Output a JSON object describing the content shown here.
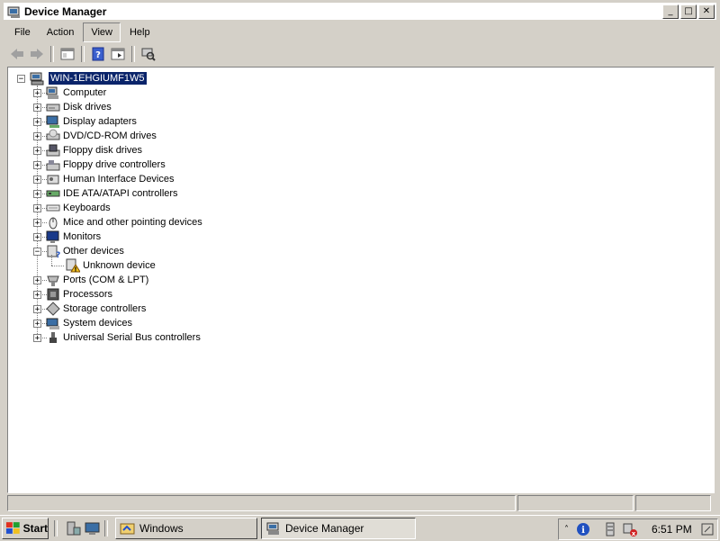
{
  "window": {
    "title": "Device Manager",
    "minimize": "_",
    "maximize": "□",
    "close": "✕"
  },
  "menu": [
    "File",
    "Action",
    "View",
    "Help"
  ],
  "toolbar": {
    "icons": [
      "back-icon",
      "forward-icon",
      "properties-pane-icon",
      "help-icon",
      "show-hide-tree-icon",
      "scan-hardware-icon"
    ]
  },
  "tree": {
    "root": "WIN-1EHGIUMF1W5",
    "categories": [
      {
        "label": "Computer",
        "icon": "computer-icon",
        "expander": "+"
      },
      {
        "label": "Disk drives",
        "icon": "disk-drive-icon",
        "expander": "+"
      },
      {
        "label": "Display adapters",
        "icon": "display-adapter-icon",
        "expander": "+"
      },
      {
        "label": "DVD/CD-ROM drives",
        "icon": "dvd-drive-icon",
        "expander": "+"
      },
      {
        "label": "Floppy disk drives",
        "icon": "floppy-drive-icon",
        "expander": "+"
      },
      {
        "label": "Floppy drive controllers",
        "icon": "floppy-controller-icon",
        "expander": "+"
      },
      {
        "label": "Human Interface Devices",
        "icon": "hid-icon",
        "expander": "+"
      },
      {
        "label": "IDE ATA/ATAPI controllers",
        "icon": "ide-controller-icon",
        "expander": "+"
      },
      {
        "label": "Keyboards",
        "icon": "keyboard-icon",
        "expander": "+"
      },
      {
        "label": "Mice and other pointing devices",
        "icon": "mouse-icon",
        "expander": "+"
      },
      {
        "label": "Monitors",
        "icon": "monitor-icon",
        "expander": "+"
      },
      {
        "label": "Other devices",
        "icon": "other-devices-icon",
        "expander": "−"
      },
      {
        "label": "Ports (COM & LPT)",
        "icon": "port-icon",
        "expander": "+"
      },
      {
        "label": "Processors",
        "icon": "processor-icon",
        "expander": "+"
      },
      {
        "label": "Storage controllers",
        "icon": "storage-controller-icon",
        "expander": "+"
      },
      {
        "label": "System devices",
        "icon": "system-device-icon",
        "expander": "+"
      },
      {
        "label": "Universal Serial Bus controllers",
        "icon": "usb-icon",
        "expander": "+"
      }
    ],
    "child": {
      "label": "Unknown device",
      "icon": "warning-device-icon"
    }
  },
  "taskbar": {
    "start": "Start",
    "tasks": [
      {
        "label": "Windows",
        "icon": "explorer-icon",
        "pressed": false
      },
      {
        "label": "Device Manager",
        "icon": "device-manager-icon",
        "pressed": true
      }
    ],
    "clock": "6:51 PM"
  },
  "colors": {
    "selection": "#0a246a",
    "chrome": "#d4d0c8",
    "pane": "#ffffff"
  }
}
